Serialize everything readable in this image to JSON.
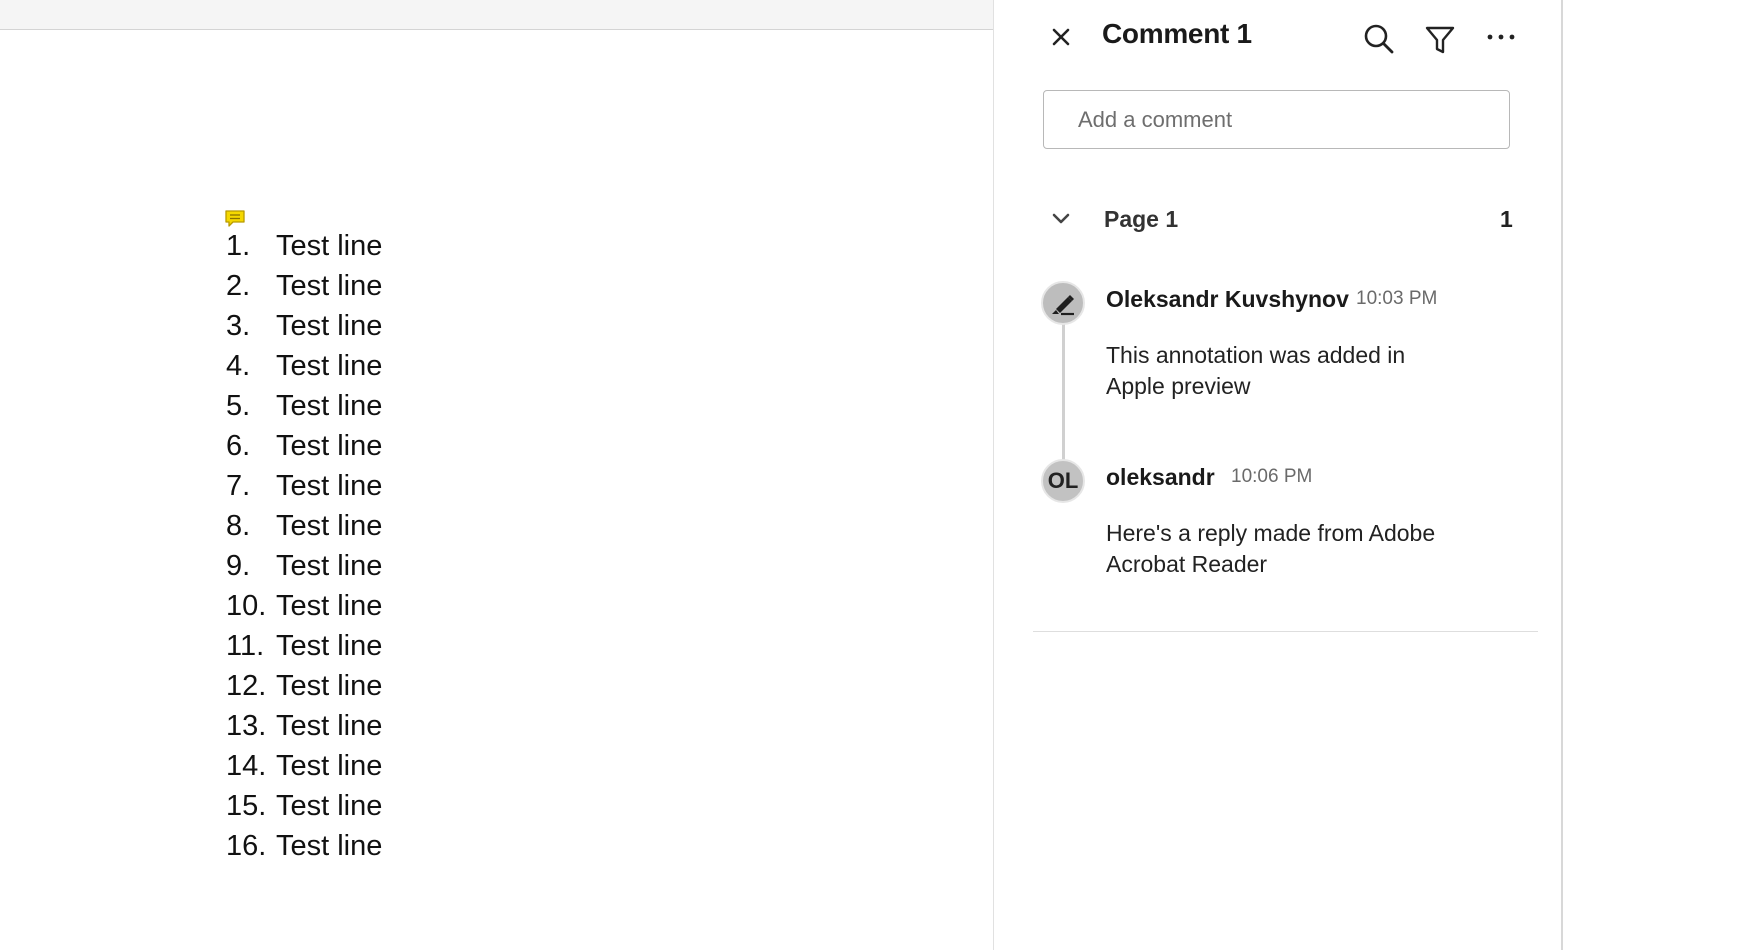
{
  "document": {
    "lines": [
      {
        "num": "1.",
        "text": "Test line"
      },
      {
        "num": "2.",
        "text": "Test line"
      },
      {
        "num": "3.",
        "text": "Test line"
      },
      {
        "num": "4.",
        "text": "Test line"
      },
      {
        "num": "5.",
        "text": "Test line"
      },
      {
        "num": "6.",
        "text": "Test line"
      },
      {
        "num": "7.",
        "text": "Test line"
      },
      {
        "num": "8.",
        "text": "Test line"
      },
      {
        "num": "9.",
        "text": "Test line"
      },
      {
        "num": "10.",
        "text": "Test line"
      },
      {
        "num": "11.",
        "text": "Test line"
      },
      {
        "num": "12.",
        "text": "Test line"
      },
      {
        "num": "13.",
        "text": "Test line"
      },
      {
        "num": "14.",
        "text": "Test line"
      },
      {
        "num": "15.",
        "text": "Test line"
      },
      {
        "num": "16.",
        "text": "Test line"
      }
    ],
    "highlight_color": "#8cc97a",
    "note_icon": "comment-note-icon",
    "note_color": "#f5d800"
  },
  "panel": {
    "title": "Comment 1",
    "search_icon": "search-icon",
    "filter_icon": "filter-icon",
    "more_icon": "more-options-icon",
    "close_icon": "close-icon",
    "add_comment_placeholder": "Add a comment",
    "page_group": {
      "label": "Page 1",
      "count": "1"
    },
    "comments": [
      {
        "author": "Oleksandr Kuvshynov",
        "time": "10:03 PM",
        "avatar_icon": "highlighter-icon",
        "body": "This annotation was added in Apple preview"
      },
      {
        "author": "oleksandr",
        "time": "10:06 PM",
        "avatar_initials": "OL",
        "body": "Here's a reply made from Adobe Acrobat Reader"
      }
    ]
  }
}
